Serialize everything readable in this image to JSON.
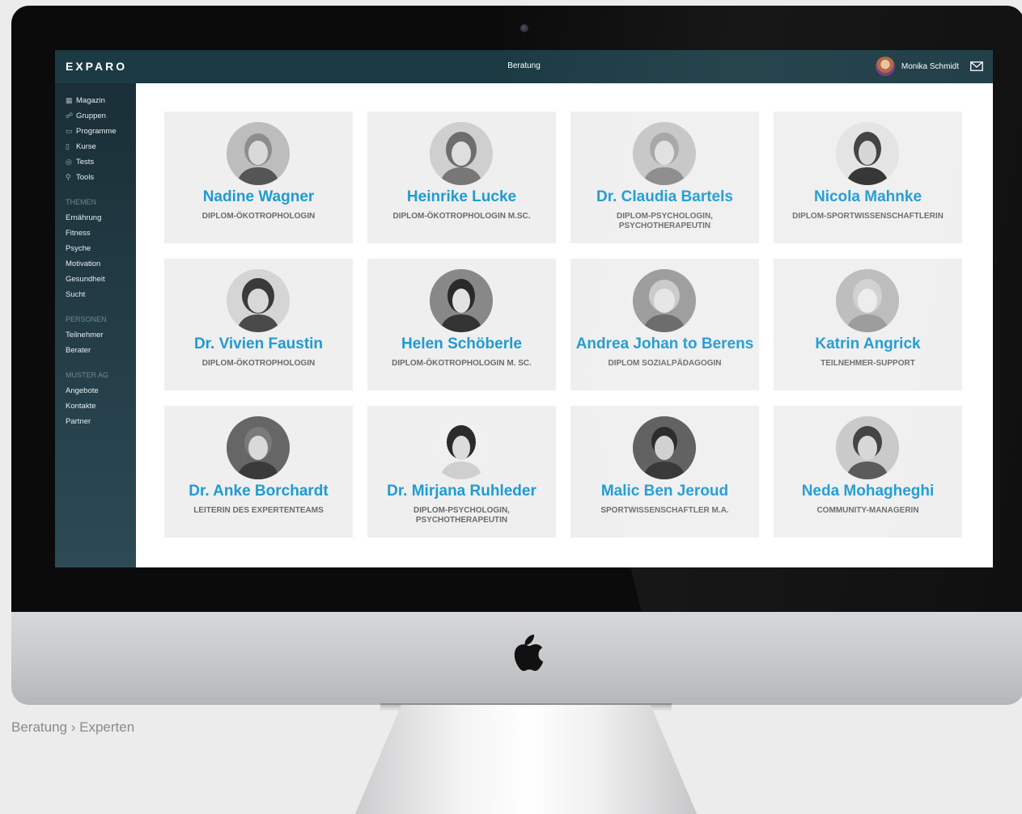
{
  "app": {
    "logo": "EXPARO",
    "title": "Beratung"
  },
  "user": {
    "name": "Monika Schmidt"
  },
  "sidebar": {
    "main": [
      {
        "label": "Magazin",
        "icon": "grid-icon"
      },
      {
        "label": "Gruppen",
        "icon": "group-icon"
      },
      {
        "label": "Programme",
        "icon": "monitor-icon"
      },
      {
        "label": "Kurse",
        "icon": "book-icon"
      },
      {
        "label": "Tests",
        "icon": "check-circle-icon"
      },
      {
        "label": "Tools",
        "icon": "tool-icon"
      }
    ],
    "themen_label": "THEMEN",
    "themen": [
      "Ernährung",
      "Fitness",
      "Psyche",
      "Motivation",
      "Gesundheit",
      "Sucht"
    ],
    "personen_label": "PERSONEN",
    "personen": [
      "Teilnehmer",
      "Berater"
    ],
    "muster_label": "MUSTER AG",
    "muster": [
      "Angebote",
      "Kontakte",
      "Partner"
    ]
  },
  "experts": [
    {
      "name": "Nadine Wagner",
      "role": "DIPLOM-ÖKOTROPHOLOGIN"
    },
    {
      "name": "Heinrike Lucke",
      "role": "DIPLOM-ÖKOTROPHOLOGIN M.SC."
    },
    {
      "name": "Dr. Claudia Bartels",
      "role": "DIPLOM-PSYCHOLOGIN, PSYCHOTHERAPEUTIN"
    },
    {
      "name": "Nicola Mahnke",
      "role": "DIPLOM-SPORTWISSENSCHAFTLERIN"
    },
    {
      "name": "Dr. Vivien Faustin",
      "role": "DIPLOM-ÖKOTROPHOLOGIN"
    },
    {
      "name": "Helen Schöberle",
      "role": "DIPLOM-ÖKOTROPHOLOGIN M. SC."
    },
    {
      "name": "Andrea Johan to Berens",
      "role": "DIPLOM SOZIALPÄDAGOGIN"
    },
    {
      "name": "Katrin Angrick",
      "role": "TEILNEHMER-SUPPORT"
    },
    {
      "name": "Dr. Anke Borchardt",
      "role": "LEITERIN DES EXPERTENTEAMS"
    },
    {
      "name": "Dr. Mirjana Ruhleder",
      "role": "DIPLOM-PSYCHOLOGIN, PSYCHOTHERAPEUTIN"
    },
    {
      "name": "Malic Ben Jeroud",
      "role": "SPORTWISSENSCHAFTLER M.A."
    },
    {
      "name": "Neda Mohagheghi",
      "role": "COMMUNITY-MANAGERIN"
    }
  ],
  "caption": "Beratung › Experten",
  "colors": {
    "accent": "#1f9bd1",
    "topbar": "#1c3a44",
    "card": "#efefef"
  }
}
